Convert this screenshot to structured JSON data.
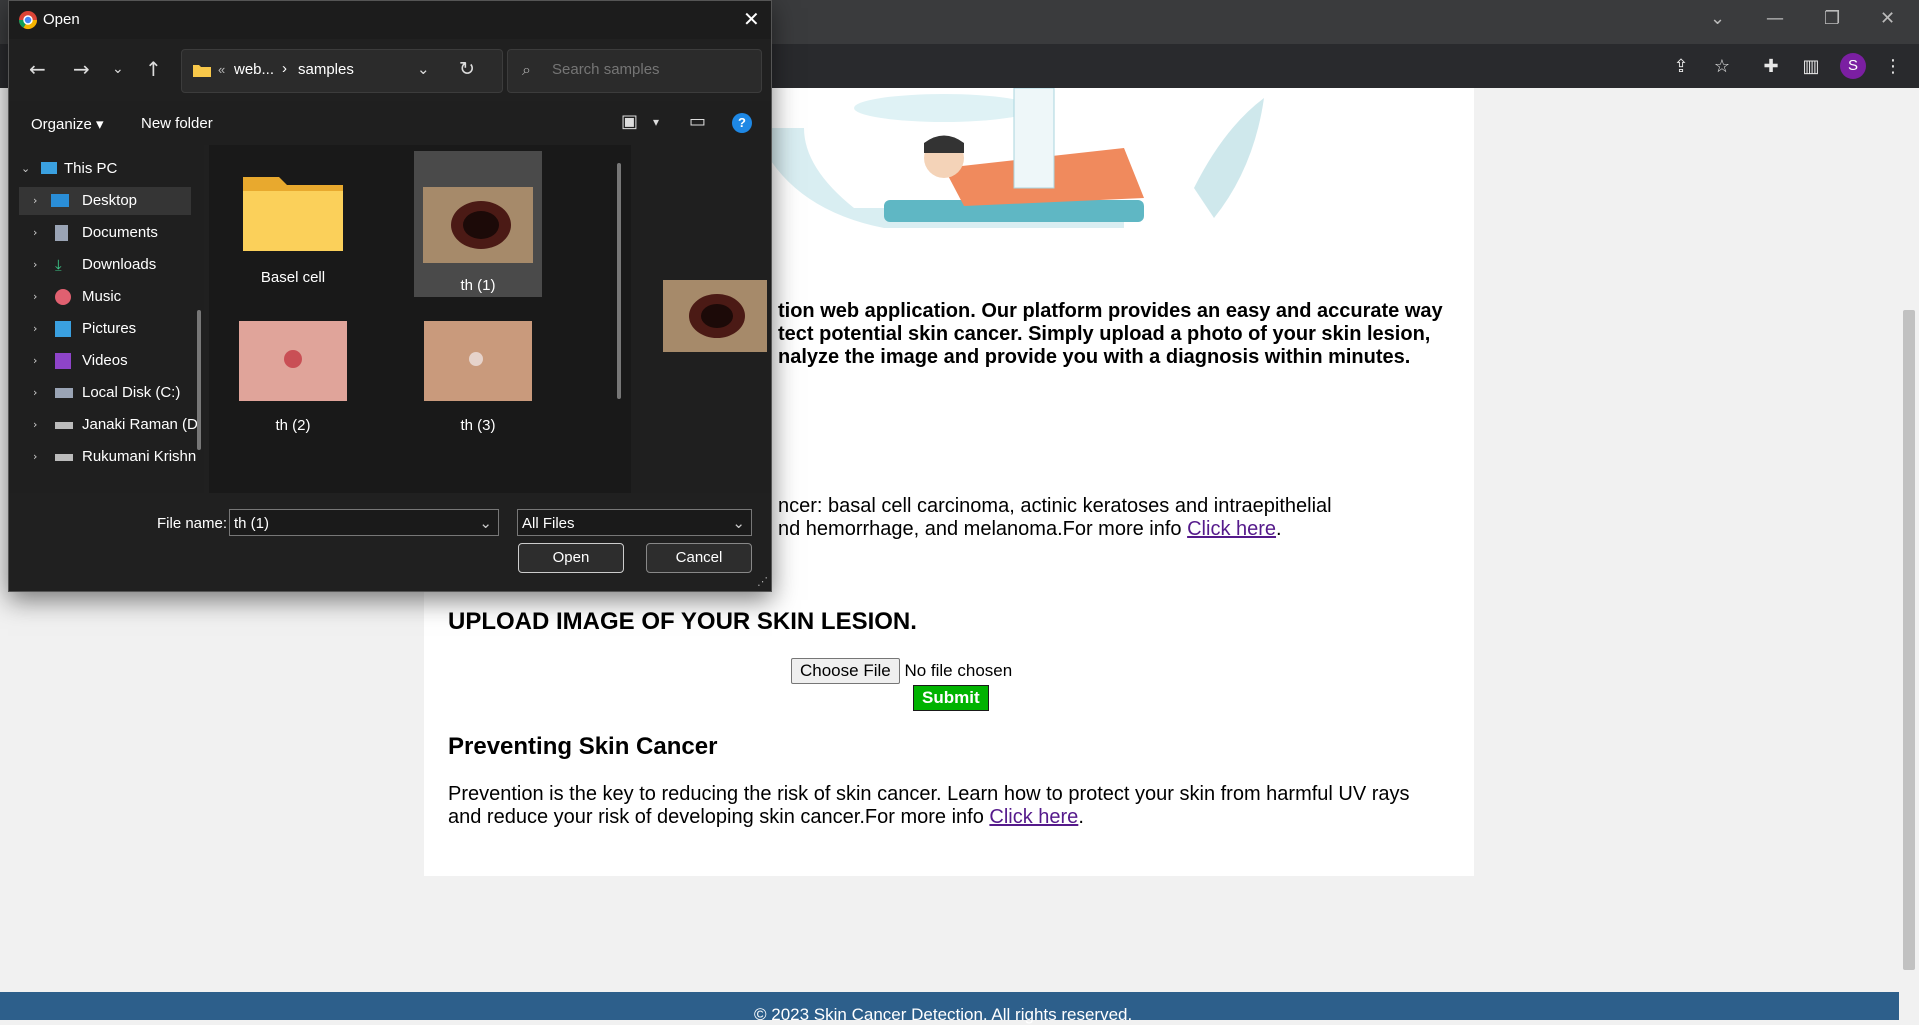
{
  "browser": {
    "colors": {
      "top": "#3a3b3d",
      "bar": "#292a2d"
    },
    "profile_initial": "S",
    "icons": [
      "share-icon",
      "star-icon",
      "extension-icon",
      "side-panel-icon",
      "more-icon",
      "tab-search-icon",
      "minimize-icon",
      "restore-icon",
      "close-icon"
    ]
  },
  "page": {
    "intro": "tion web application. Our platform provides an easy and accurate way tect potential skin cancer. Simply upload a photo of your skin lesion, nalyze the image and provide you with a diagnosis within minutes.",
    "intro_lines": [
      "tion web application. Our platform provides an easy and accurate way",
      "tect potential skin cancer. Simply upload a photo of your skin lesion,",
      "nalyze the image and provide you with a diagnosis within minutes."
    ],
    "types_line1": "ncer: basal cell carcinoma, actinic keratoses and intraepithelial",
    "types_line2_prefix": "nd hemorrhage, and melanoma.For more info ",
    "types_link": "Click here",
    "types_suffix": ".",
    "upload_heading": "UPLOAD IMAGE OF YOUR SKIN LESION.",
    "choose_file_label": "Choose File",
    "no_file_text": "No file chosen",
    "submit_label": "Submit",
    "prevent_heading": "Preventing Skin Cancer",
    "prevent_line1": "Prevention is the key to reducing the risk of skin cancer. Learn how to protect your skin from harmful UV rays",
    "prevent_line2_prefix": "and reduce your risk of developing skin cancer.For more info ",
    "prevent_link": "Click here",
    "prevent_suffix": ".",
    "footer": "© 2023 Skin Cancer Detection. All rights reserved.",
    "colors": {
      "submit": "#00b300",
      "footer": "#2d5f8b",
      "link": "#551a8b"
    }
  },
  "dialog": {
    "title": "Open",
    "path_parts": [
      "«",
      "web...",
      "›",
      "samples"
    ],
    "search_placeholder": "Search samples",
    "organize_label": "Organize ▾",
    "new_folder_label": "New folder",
    "tree": [
      {
        "label": "This PC",
        "icon": "pc-icon"
      },
      {
        "label": "Desktop",
        "icon": "desktop-icon",
        "selected": true
      },
      {
        "label": "Documents",
        "icon": "documents-icon"
      },
      {
        "label": "Downloads",
        "icon": "downloads-icon"
      },
      {
        "label": "Music",
        "icon": "music-icon"
      },
      {
        "label": "Pictures",
        "icon": "pictures-icon"
      },
      {
        "label": "Videos",
        "icon": "videos-icon"
      },
      {
        "label": "Local Disk (C:)",
        "icon": "disk-icon"
      },
      {
        "label": "Janaki Raman (D",
        "icon": "drive-icon"
      },
      {
        "label": "Rukumani Krishn",
        "icon": "drive-icon"
      }
    ],
    "files": [
      {
        "name": "Basel cell",
        "type": "folder"
      },
      {
        "name": "th (1)",
        "type": "image",
        "selected": true
      },
      {
        "name": "th (2)",
        "type": "image"
      },
      {
        "name": "th (3)",
        "type": "image"
      }
    ],
    "file_name_label": "File name:",
    "file_name_value": "th (1)",
    "filter_value": "All Files",
    "open_label": "Open",
    "cancel_label": "Cancel"
  }
}
